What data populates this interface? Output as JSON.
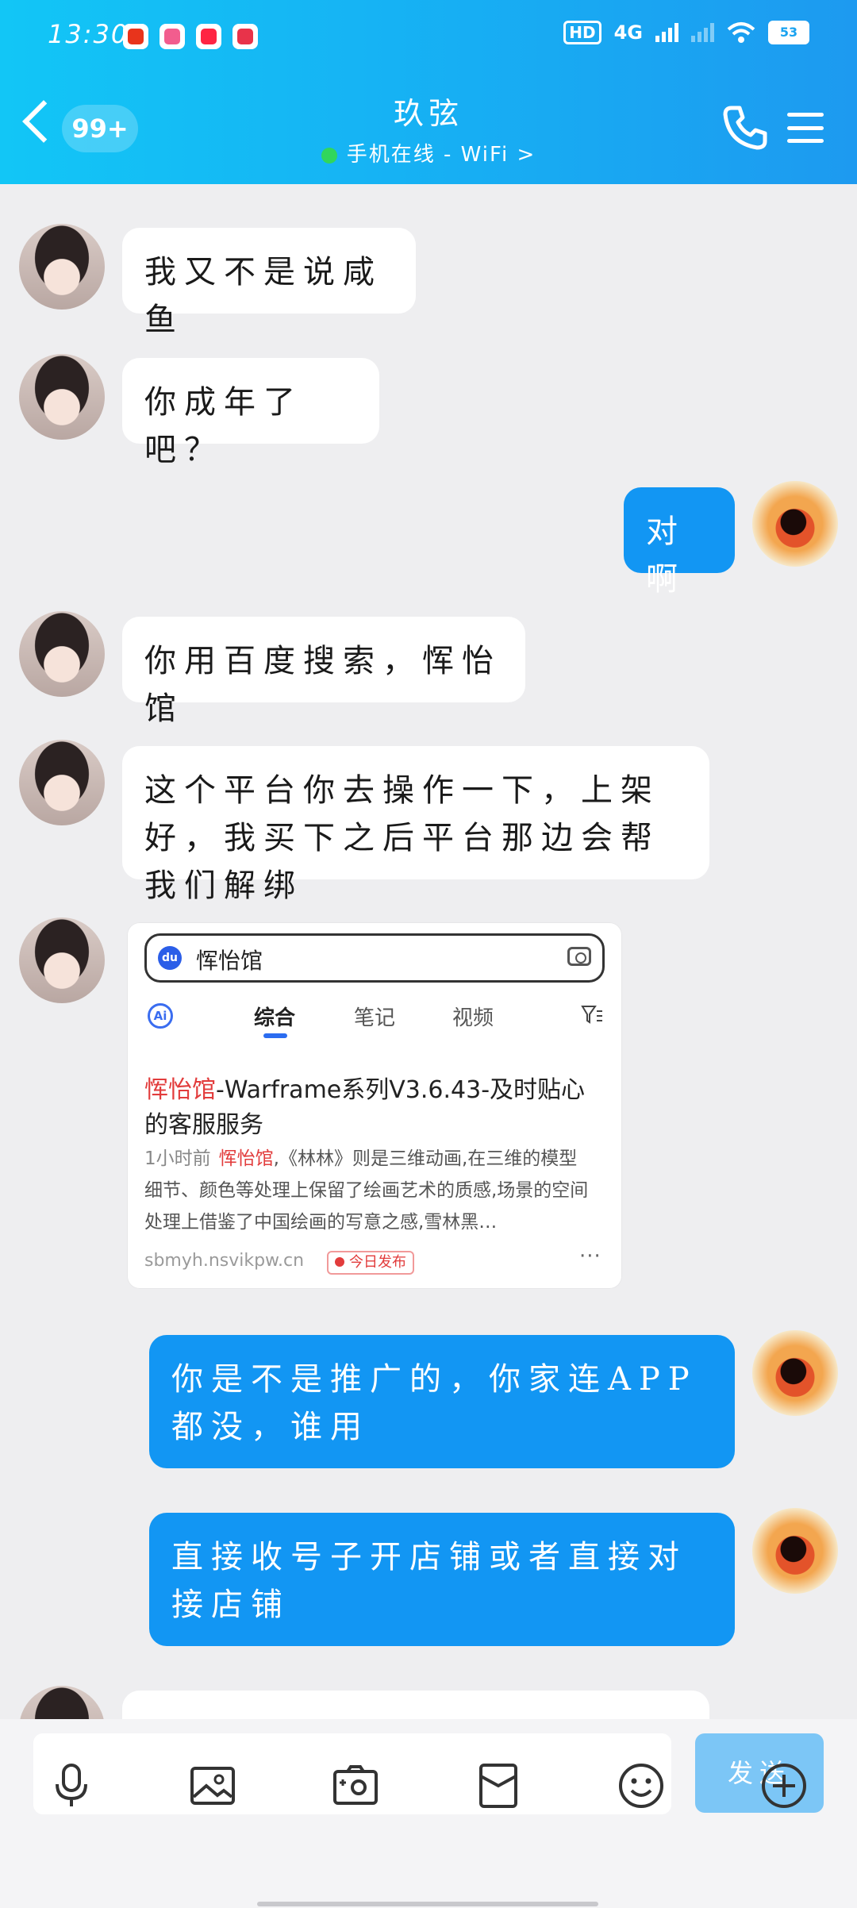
{
  "status_bar": {
    "time": "13:30",
    "network": "4G",
    "hd": "HD",
    "sim": "1",
    "battery": "53"
  },
  "header": {
    "unread_badge": "99+",
    "contact_name": "玖弦",
    "status": "手机在线 - WiFi",
    "status_chevron": ">"
  },
  "messages": [
    {
      "sender": "them",
      "text": "我又不是说咸鱼"
    },
    {
      "sender": "them",
      "text": "你成年了吧？"
    },
    {
      "sender": "me",
      "text": "对啊"
    },
    {
      "sender": "them",
      "text": "你用百度搜索，恽怡馆"
    },
    {
      "sender": "them",
      "text": "这个平台你去操作一下，上架好，我买下之后平台那边会帮我们解绑"
    },
    {
      "sender": "me",
      "text": "你是不是推广的，你家连APP都没，谁用"
    },
    {
      "sender": "me",
      "text": "直接收号子开店铺或者直接对接店铺"
    }
  ],
  "search_card": {
    "query": "恽怡馆",
    "ai_label": "Ai",
    "tabs": [
      "综合",
      "笔记",
      "视频"
    ],
    "result": {
      "title_highlight": "恽怡馆",
      "title_rest": "-Warframe系列V3.6.43-及时贴心的客服服务",
      "time": "1小时前",
      "body_highlight": "恽怡馆",
      "body_rest": ",《林林》则是三维动画,在三维的模型细节、颜色等处理上保留了绘画艺术的质感,场景的空间处理上借鉴了中国绘画的写意之感,雪林黑…",
      "site": "sbmyh.nsvikpw.cn",
      "tag": "今日发布",
      "more": "···"
    }
  },
  "composer": {
    "send_label": "发送",
    "input_value": ""
  },
  "toolbar_icons": [
    "microphone-icon",
    "image-icon",
    "camera-icon",
    "red-packet-icon",
    "emoji-icon",
    "plus-icon"
  ],
  "colors": {
    "header_start": "#12c6f6",
    "header_end": "#1d9af0",
    "outgoing_bubble": "#1296f3",
    "incoming_bubble": "#ffffff",
    "send_button": "#7cc6f6",
    "highlight_red": "#e23c3c"
  }
}
